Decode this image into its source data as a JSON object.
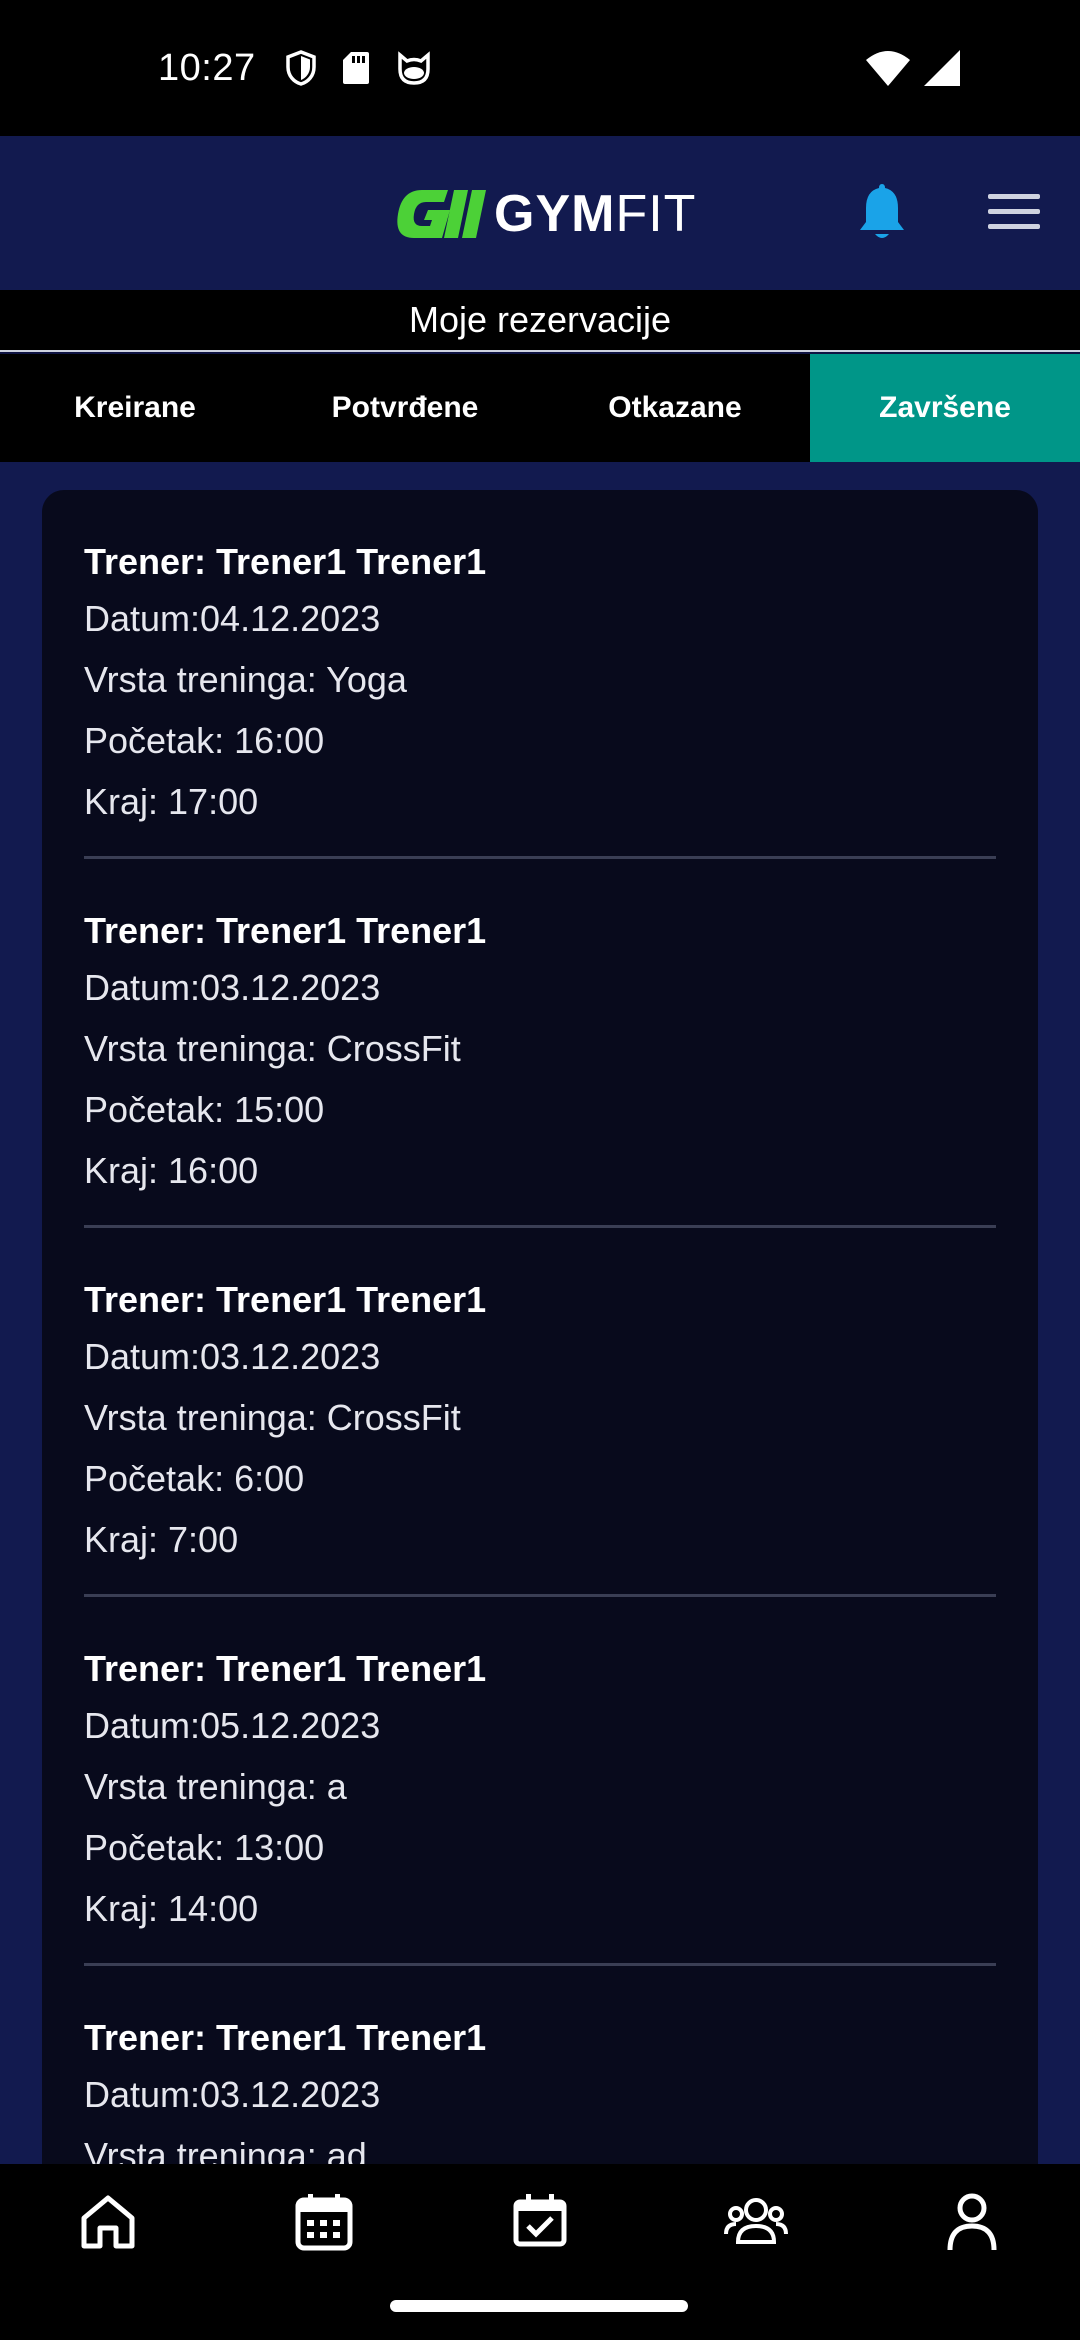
{
  "status_bar": {
    "time": "10:27",
    "icons": [
      "shield-icon",
      "sd-card-icon",
      "cat-face-icon",
      "wifi-icon",
      "cell-signal-icon"
    ]
  },
  "header": {
    "logo_text_bold": "GYM",
    "logo_text_light": "FIT",
    "logo_color": "#4cd137",
    "bell_color": "#1aa3e8"
  },
  "page_title": "Moje rezervacije",
  "tabs": [
    {
      "label": "Kreirane",
      "active": false
    },
    {
      "label": "Potvrđene",
      "active": false
    },
    {
      "label": "Otkazane",
      "active": false
    },
    {
      "label": "Završene",
      "active": true
    }
  ],
  "accent_color": "#009688",
  "reservations": [
    {
      "trainer": "Trener: Trener1 Trener1",
      "date": "Datum:04.12.2023",
      "type": "Vrsta treninga: Yoga",
      "start": "Početak: 16:00",
      "end": "Kraj: 17:00"
    },
    {
      "trainer": "Trener: Trener1 Trener1",
      "date": "Datum:03.12.2023",
      "type": "Vrsta treninga: CrossFit",
      "start": "Početak: 15:00",
      "end": "Kraj: 16:00"
    },
    {
      "trainer": "Trener: Trener1 Trener1",
      "date": "Datum:03.12.2023",
      "type": "Vrsta treninga: CrossFit",
      "start": "Početak: 6:00",
      "end": "Kraj: 7:00"
    },
    {
      "trainer": "Trener: Trener1 Trener1",
      "date": "Datum:05.12.2023",
      "type": "Vrsta treninga: a",
      "start": "Početak: 13:00",
      "end": "Kraj: 14:00"
    },
    {
      "trainer": "Trener: Trener1 Trener1",
      "date": "Datum:03.12.2023",
      "type": "Vrsta treninga: ad",
      "start": "",
      "end": ""
    }
  ],
  "bottom_nav": [
    "home-icon",
    "calendar-icon",
    "calendar-check-icon",
    "group-icon",
    "profile-icon"
  ]
}
